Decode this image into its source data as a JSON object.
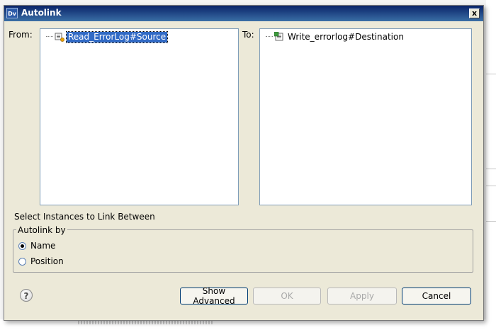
{
  "window": {
    "title": "Autolink",
    "app_icon_text": "Dv",
    "close_symbol": "x"
  },
  "from_pane": {
    "label": "From:",
    "items": [
      {
        "label": "Read_ErrorLog#Source",
        "icon": "source-node-icon",
        "selected": true
      }
    ]
  },
  "to_pane": {
    "label": "To:",
    "items": [
      {
        "label": "Write_errorlog#Destination",
        "icon": "destination-node-icon",
        "selected": false
      }
    ]
  },
  "instructions": "Select Instances to Link Between",
  "autolink_group": {
    "legend": "Autolink by",
    "options": [
      {
        "label": "Name",
        "checked": true
      },
      {
        "label": "Position",
        "checked": false
      }
    ]
  },
  "buttons": {
    "show_advanced": "Show Advanced",
    "ok": "OK",
    "apply": "Apply",
    "cancel": "Cancel"
  },
  "colors": {
    "titlebar": "#0a246a",
    "dialog_bg": "#ece9d8",
    "selection": "#316ac5"
  }
}
